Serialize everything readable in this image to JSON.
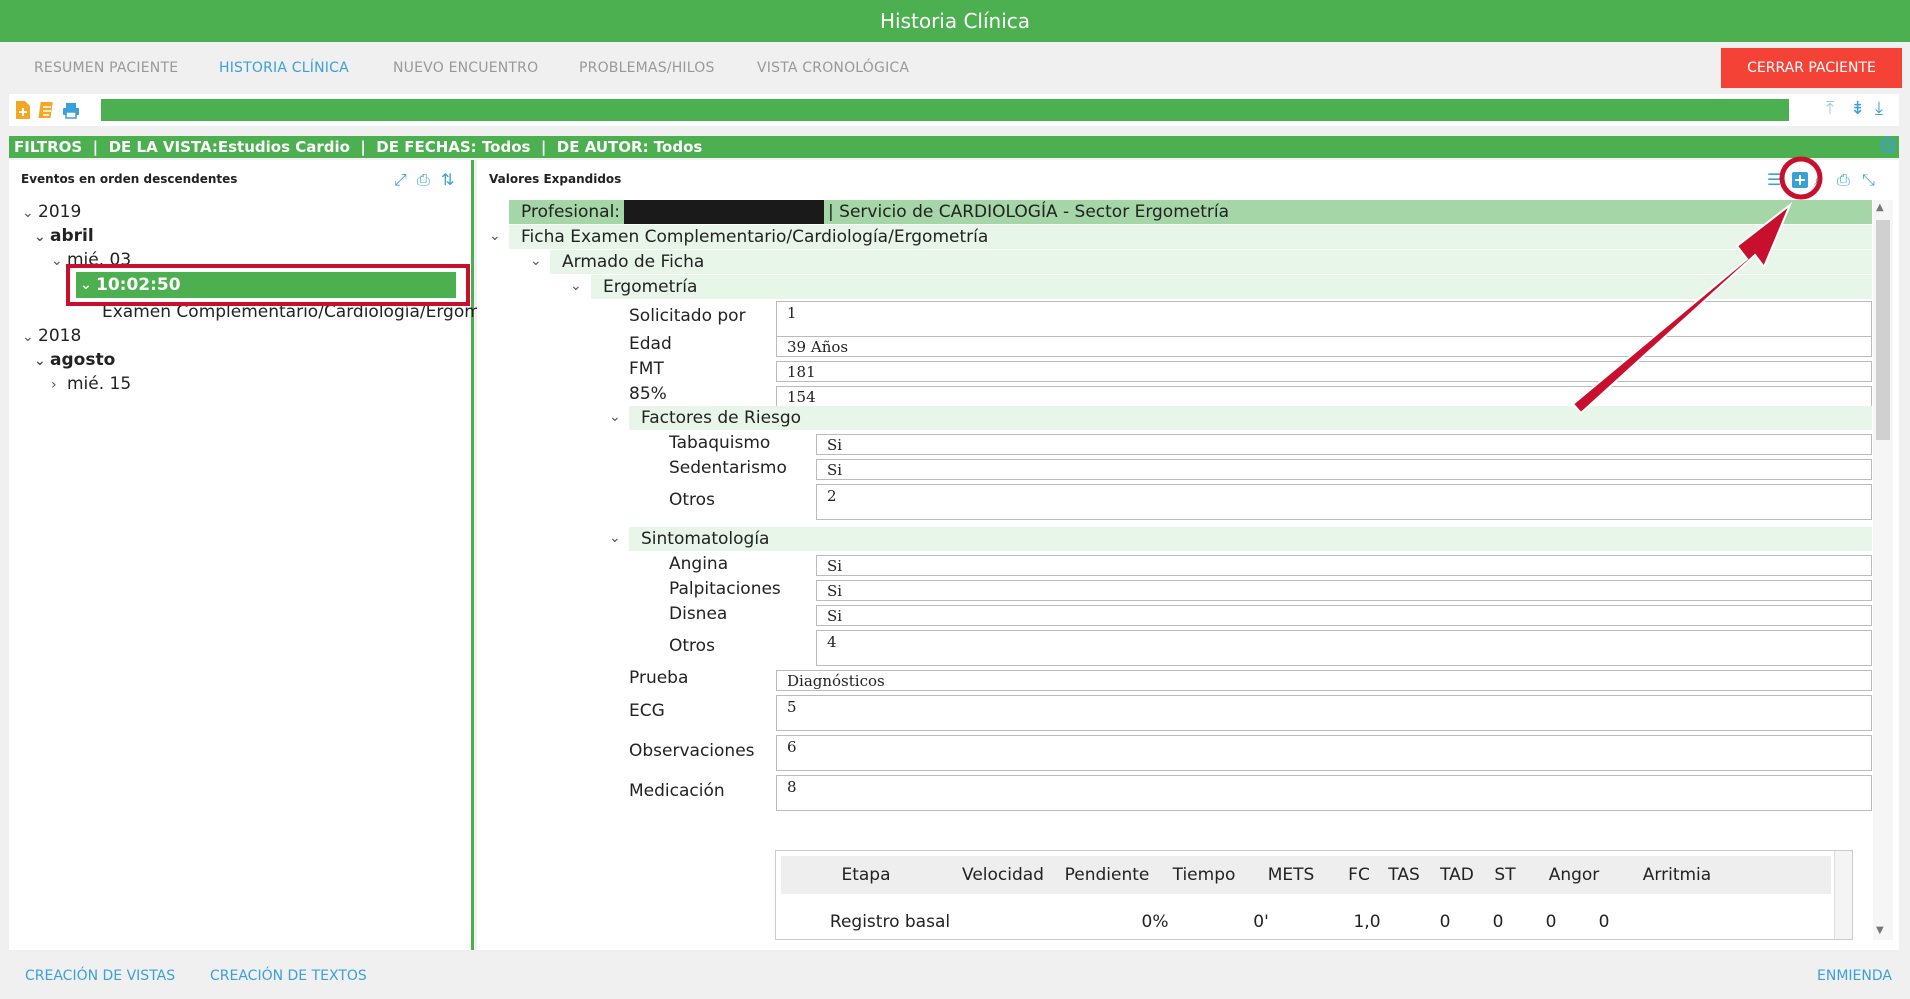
{
  "window": {
    "title": "Historia Clínica"
  },
  "nav": {
    "tabs": [
      "RESUMEN PACIENTE",
      "HISTORIA CLÍNICA",
      "NUEVO ENCUENTRO",
      "PROBLEMAS/HILOS",
      "VISTA CRONOLÓGICA"
    ],
    "active_tab": "HISTORIA CLÍNICA",
    "close_label": "CERRAR PACIENTE"
  },
  "filters": {
    "text": "FILTROS  |  DE LA VISTA:Estudios Cardio  |  DE FECHAS: Todos  |  DE AUTOR: Todos"
  },
  "left_panel": {
    "title": "Eventos en orden descendentes",
    "tree": {
      "year1": "2019",
      "month1": "abril",
      "day1": "mié. 03",
      "time1": "10:02:50",
      "event1": "Examen Complementario/Cardiología/Ergometrí",
      "year2": "2018",
      "month2": "agosto",
      "day2": "mié. 15"
    }
  },
  "right_panel": {
    "title": "Valores Expandidos",
    "profesional_label": "Profesional:",
    "servicio": "| Servicio de CARDIOLOGÍA - Sector Ergometría",
    "ficha": "Ficha Examen Complementario/Cardiología/Ergometría",
    "armado": "Armado de Ficha",
    "ergometria": "Ergometría",
    "fields": {
      "solicitado_label": "Solicitado por",
      "solicitado_val": "1",
      "edad_label": "Edad",
      "edad_val": "39 Años",
      "fmt_label": "FMT",
      "fmt_val": "181",
      "p85_label": "85%",
      "p85_val": "154",
      "factores": "Factores de Riesgo",
      "tabaquismo_label": "Tabaquismo",
      "tabaquismo_val": "Si",
      "sedentarismo_label": "Sedentarismo",
      "sedentarismo_val": "Si",
      "otros1_label": "Otros",
      "otros1_val": "2",
      "sintomatologia": "Sintomatología",
      "angina_label": "Angina",
      "angina_val": "Si",
      "palpitaciones_label": "Palpitaciones",
      "palpitaciones_val": "Si",
      "disnea_label": "Disnea",
      "disnea_val": "Si",
      "otros2_label": "Otros",
      "otros2_val": "4",
      "prueba_label": "Prueba",
      "prueba_val": "Diagnósticos",
      "ecg_label": "ECG",
      "ecg_val": "5",
      "observaciones_label": "Observaciones",
      "observaciones_val": "6",
      "medicacion_label": "Medicación",
      "medicacion_val": "8"
    },
    "table": {
      "headers": [
        "Etapa",
        "Velocidad",
        "Pendiente",
        "Tiempo",
        "METS",
        "FC",
        "TAS",
        "TAD",
        "ST",
        "Angor",
        "Arritmia"
      ],
      "rows": [
        [
          "Registro basal",
          "",
          "0%",
          "0'",
          "1,0",
          "0",
          "0",
          "0",
          "0",
          "",
          ""
        ]
      ]
    }
  },
  "footer": {
    "left_links": [
      "CREACIÓN DE VISTAS",
      "CREACIÓN DE TEXTOS"
    ],
    "right_link": "ENMIENDA"
  },
  "colors": {
    "primary_green": "#4caf50",
    "accent_blue": "#3aa0d8",
    "close_red": "#f44336",
    "annotation_red": "#c8102e"
  }
}
